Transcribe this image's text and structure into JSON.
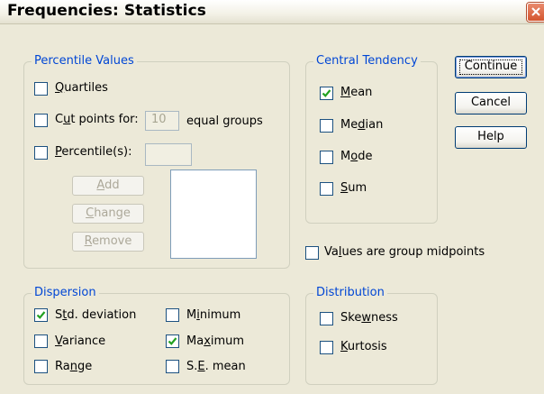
{
  "window": {
    "title": "Frequencies: Statistics",
    "accent_color": "#0046d5",
    "close_color": "#d4562f"
  },
  "percentile_values": {
    "legend": "Percentile Values",
    "quartiles": {
      "label_pre": "",
      "mnemonic": "Q",
      "label_post": "uartiles",
      "checked": false
    },
    "cut_points": {
      "label_pre": "C",
      "mnemonic": "u",
      "label_post": "t points for:",
      "checked": false,
      "value": "10",
      "suffix": "equal groups"
    },
    "percentiles": {
      "label_pre": "",
      "mnemonic": "P",
      "label_post": "ercentile(s):",
      "checked": false,
      "value": ""
    },
    "buttons": {
      "add": {
        "label_pre": "",
        "mnemonic": "A",
        "label_post": "dd"
      },
      "change": {
        "label_pre": "",
        "mnemonic": "C",
        "label_post": "hange"
      },
      "remove": {
        "label_pre": "",
        "mnemonic": "R",
        "label_post": "emove"
      }
    }
  },
  "central_tendency": {
    "legend": "Central Tendency",
    "mean": {
      "label_pre": "",
      "mnemonic": "M",
      "label_post": "ean",
      "checked": true
    },
    "median": {
      "label_pre": "Me",
      "mnemonic": "d",
      "label_post": "ian",
      "checked": false
    },
    "mode": {
      "label_pre": "M",
      "mnemonic": "o",
      "label_post": "de",
      "checked": false
    },
    "sum": {
      "label_pre": "",
      "mnemonic": "S",
      "label_post": "um",
      "checked": false
    }
  },
  "actions": {
    "continue": "Continue",
    "cancel": "Cancel",
    "help": "Help"
  },
  "group_midpoints": {
    "label_pre": "Va",
    "mnemonic": "l",
    "label_post": "ues are group midpoints",
    "checked": false
  },
  "dispersion": {
    "legend": "Dispersion",
    "std_deviation": {
      "label_pre": "S",
      "mnemonic": "t",
      "label_post": "d. deviation",
      "checked": true
    },
    "variance": {
      "label_pre": "",
      "mnemonic": "V",
      "label_post": "ariance",
      "checked": false
    },
    "range": {
      "label_pre": "Ra",
      "mnemonic": "n",
      "label_post": "ge",
      "checked": false
    },
    "minimum": {
      "label_pre": "M",
      "mnemonic": "i",
      "label_post": "nimum",
      "checked": false
    },
    "maximum": {
      "label_pre": "Ma",
      "mnemonic": "x",
      "label_post": "imum",
      "checked": true
    },
    "se_mean": {
      "label_pre": "S.",
      "mnemonic": "E",
      "label_post": ". mean",
      "checked": false
    }
  },
  "distribution": {
    "legend": "Distribution",
    "skewness": {
      "label_pre": "Ske",
      "mnemonic": "w",
      "label_post": "ness",
      "checked": false
    },
    "kurtosis": {
      "label_pre": "",
      "mnemonic": "K",
      "label_post": "urtosis",
      "checked": false
    }
  }
}
